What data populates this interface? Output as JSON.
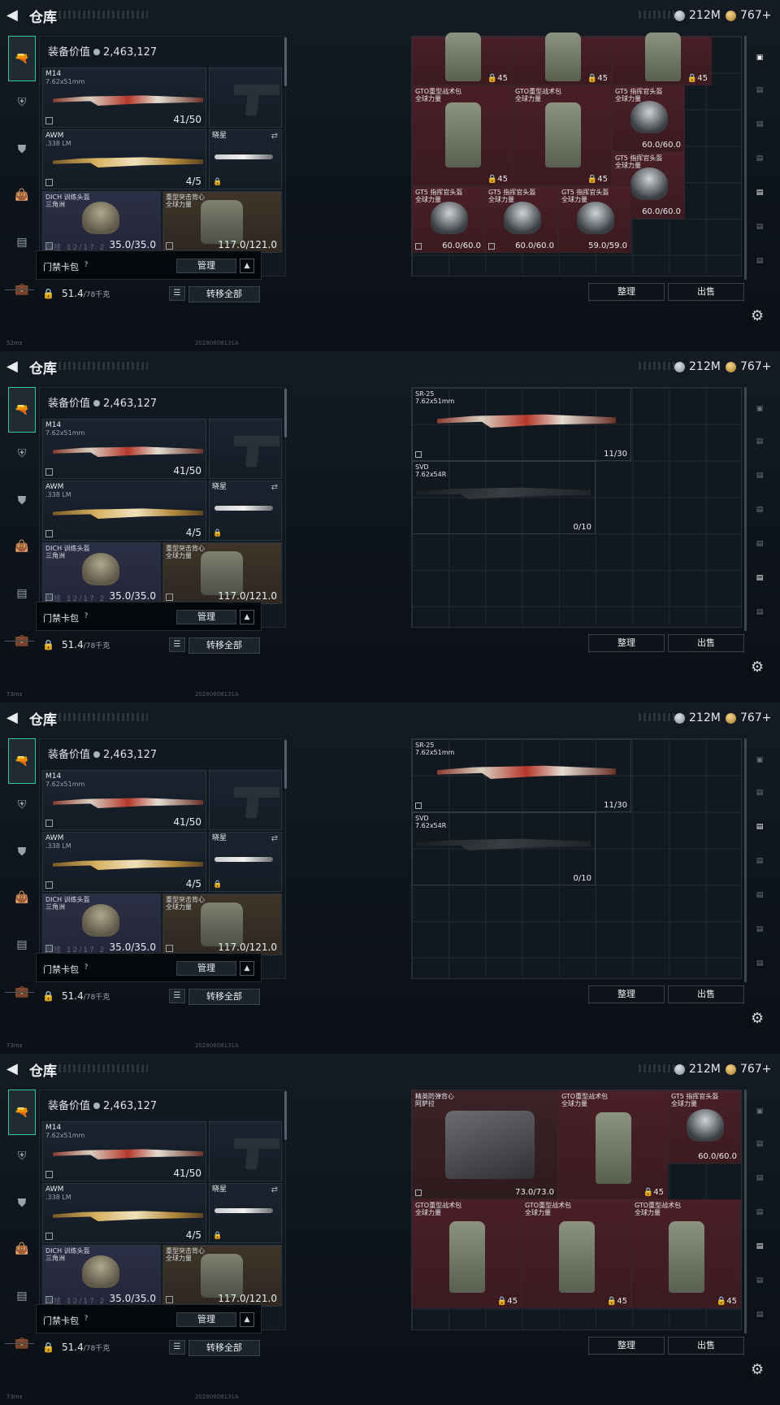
{
  "topbar": {
    "title": "仓库",
    "currency1": "212M",
    "currency2": "767+"
  },
  "loadout": {
    "value_label": "装备价值",
    "value": "2,463,127",
    "primary1": {
      "name": "M14",
      "caliber": "7.62x51mm",
      "ammo": "41/50"
    },
    "primary2": {
      "name": "AWM",
      "caliber": ".338 LM",
      "ammo": "4/5"
    },
    "melee": {
      "name": "晓星"
    },
    "helmet": {
      "name": "DICH 训练头盔",
      "sub": "三角洲",
      "dur": "35.0/35.0"
    },
    "armor": {
      "name": "重型突击背心",
      "sub": "全球力量",
      "dur": "117.0/121.0"
    },
    "partial_row": "胸挂   12/17   2",
    "card_pack": "门禁卡包",
    "card_q": "?",
    "manage": "管理",
    "weight": "51.4",
    "weight_max": "/78千克",
    "transfer_all": "转移全部"
  },
  "panels": [
    {
      "status": "52ms",
      "grid_items": [
        {
          "cap": "45"
        },
        {
          "cap": "45"
        },
        {
          "cap": "45"
        },
        {
          "name": "GTO重型战术包",
          "sub": "全球力量",
          "cap": "45"
        },
        {
          "name": "GTO重型战术包",
          "sub": "全球力量",
          "cap": "45"
        },
        {
          "name": "GT5 指挥官头盔",
          "sub": "全球力量",
          "dur": "60.0/60.0"
        },
        {
          "name": "GT5 指挥官头盔",
          "sub": "全球力量",
          "dur": "60.0/60.0"
        },
        {
          "name": "GT5 指挥官头盔",
          "sub": "全球力量",
          "dur": "60.0/60.0"
        },
        {
          "name": "GT5 指挥官头盔",
          "sub": "全球力量",
          "dur": "60.0/60.0"
        },
        {
          "name": "GT5 指挥官头盔",
          "sub": "全球力量",
          "dur": "59.0/59.0"
        }
      ]
    },
    {
      "status": "73ms",
      "grid_items": [
        {
          "name": "SR-25",
          "sub": "7.62x51mm",
          "dur": "11/30"
        },
        {
          "name": "SVD",
          "sub": "7.62x54R",
          "dur": "0/10"
        }
      ]
    },
    {
      "status": "73ms",
      "grid_items": [
        {
          "name": "SR-25",
          "sub": "7.62x51mm",
          "dur": "11/30"
        },
        {
          "name": "SVD",
          "sub": "7.62x54R",
          "dur": "0/10"
        }
      ]
    },
    {
      "status": "73ms",
      "grid_items": [
        {
          "name": "精英防弹背心",
          "sub": "阿萨拉",
          "dur": "73.0/73.0"
        },
        {
          "name": "GTO重型战术包",
          "sub": "全球力量",
          "cap": "45"
        },
        {
          "name": "GT5 指挥官头盔",
          "sub": "全球力量",
          "dur": "60.0/60.0"
        },
        {
          "name": "GTO重型战术包",
          "sub": "全球力量",
          "cap": "45"
        },
        {
          "name": "GTO重型战术包",
          "sub": "全球力量",
          "cap": "45"
        },
        {
          "name": "GTO重型战术包",
          "sub": "全球力量",
          "cap": "45"
        }
      ]
    }
  ],
  "timestamp": "20280808131A",
  "sort": "整理",
  "sell": "出售",
  "colors": {
    "accent": "#2ec9a0",
    "item_red": "#4a1f27"
  }
}
